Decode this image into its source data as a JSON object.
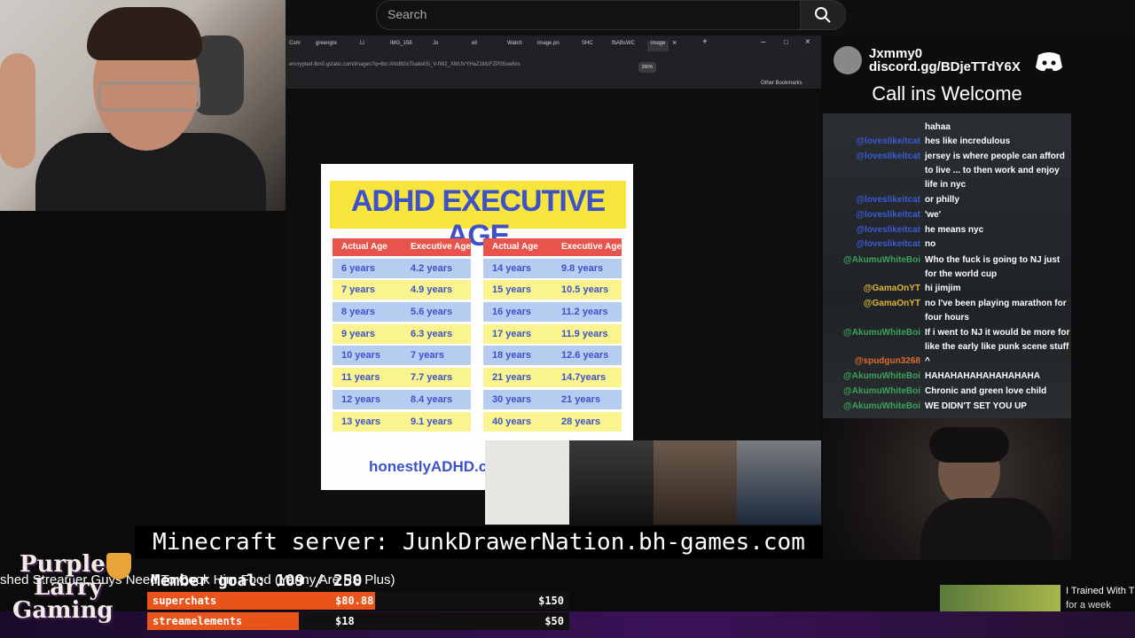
{
  "search": {
    "placeholder": "Search"
  },
  "browser": {
    "tabs": [
      "Com",
      "greengre",
      "Ll",
      "IMG_158",
      "Jo",
      "ell",
      "Watch",
      "image.pn",
      "SHC",
      "fbABsWC",
      "image"
    ],
    "url": "encrypted-tbn0.gstatic.com/images?q=tbn:ANd9GcToaketSi_V-fW2_XltrUVYHeZ1MzFZP05sw8xs",
    "zoom": "280%",
    "other_bookmarks": "Other Bookmarks"
  },
  "adhd_chart": {
    "title": "ADHD EXECUTIVE AGE",
    "headers": [
      "Actual Age",
      "Executive Age"
    ],
    "left_rows": [
      [
        "6 years",
        "4.2 years"
      ],
      [
        "7 years",
        "4.9 years"
      ],
      [
        "8 years",
        "5.6 years"
      ],
      [
        "9 years",
        "6.3 years"
      ],
      [
        "10 years",
        "7 years"
      ],
      [
        "11 years",
        "7.7 years"
      ],
      [
        "12 years",
        "8.4 years"
      ],
      [
        "13 years",
        "9.1 years"
      ]
    ],
    "right_rows": [
      [
        "14 years",
        "9.8 years"
      ],
      [
        "15 years",
        "10.5 years"
      ],
      [
        "16 years",
        "11.2 years"
      ],
      [
        "17 years",
        "11.9 years"
      ],
      [
        "18 years",
        "12.6 years"
      ],
      [
        "21 years",
        "14.7years"
      ],
      [
        "30 years",
        "21 years"
      ],
      [
        "40 years",
        "28 years"
      ]
    ],
    "footer": "honestlyADHD.co",
    "colors": {
      "title_bg": "#f7e43c",
      "text": "#3d52c9",
      "header_bg": "#e8544c",
      "row_blue": "#b7cdf0",
      "row_yellow": "#f9f48d"
    }
  },
  "minecraft": "Minecraft server: JunkDrawerNation.bh-games.com",
  "discord": {
    "name": "Jxmmy0",
    "link": "discord.gg/BDjeTTdY6X",
    "callins": "Call ins Welcome"
  },
  "chat": [
    {
      "user": "",
      "text": "hahaa",
      "color": "#3aa35c"
    },
    {
      "user": "@loveslikeitcat",
      "text": "hes like incredulous",
      "color": "#3a5bd6"
    },
    {
      "user": "@loveslikeitcat",
      "text": "jersey is where people can afford to live ... to then work and enjoy life in nyc",
      "color": "#3a5bd6"
    },
    {
      "user": "@loveslikeitcat",
      "text": "or philly",
      "color": "#3a5bd6"
    },
    {
      "user": "@loveslikeitcat",
      "text": "'we'",
      "color": "#3a5bd6"
    },
    {
      "user": "@loveslikeitcat",
      "text": "he means nyc",
      "color": "#3a5bd6"
    },
    {
      "user": "@loveslikeitcat",
      "text": "no",
      "color": "#3a5bd6"
    },
    {
      "user": "@AkumuWhiteBoi",
      "text": "Who the fuck is going to NJ just for the world cup",
      "color": "#3aa35c"
    },
    {
      "user": "@GamaOnYT",
      "text": "hi jimjim",
      "color": "#e0b43a"
    },
    {
      "user": "@GamaOnYT",
      "text": "no I've been playing marathon for four hours",
      "color": "#e0b43a"
    },
    {
      "user": "@AkumuWhiteBoi",
      "text": "If i went to NJ it would be more for like the early like punk scene stuff",
      "color": "#3aa35c"
    },
    {
      "user": "@spudgun3268",
      "text": "^",
      "color": "#e06a2a"
    },
    {
      "user": "@AkumuWhiteBoi",
      "text": "HAHAHAHAHAHAHAHAHA",
      "color": "#3aa35c"
    },
    {
      "user": "@AkumuWhiteBoi",
      "text": "Chronic and green love child",
      "color": "#3aa35c"
    },
    {
      "user": "@AkumuWhiteBoi",
      "text": "WE DIDN'T SET YOU UP",
      "color": "#3aa35c"
    }
  ],
  "ticker": "shed  Streamer Guys Need To Cook Him Food (Yanny Are PS Plus)",
  "member_goal": "Member goal: 109 / 250",
  "logo_text": [
    "Purple",
    "Larry",
    "Gaming"
  ],
  "goals": [
    {
      "name": "superchats",
      "current": "$80.88",
      "target": "$150",
      "progress": 0.54
    },
    {
      "name": "streamelements",
      "current": "$18",
      "target": "$50",
      "progress": 0.36
    }
  ],
  "recommended": {
    "title": "I Trained With T",
    "subtitle": "for a week"
  }
}
